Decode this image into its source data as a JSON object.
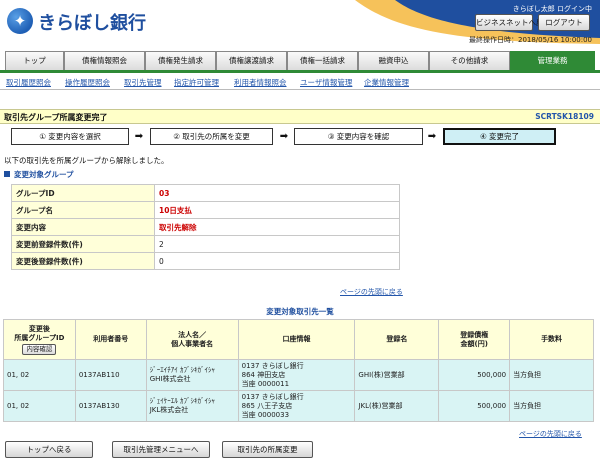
{
  "header": {
    "logo_text": "きらぼし銀行",
    "user_line": "きらぼし太郎 ログイン中",
    "biz_button": "ビジネスネットへ戻る",
    "logout_button": "ログアウト",
    "last_login": "最終操作日時：2018/05/16 10:00:00"
  },
  "tabs": [
    {
      "label": "トップ",
      "active": false
    },
    {
      "label": "債権情報照会",
      "active": false
    },
    {
      "label": "債権発生請求",
      "active": false
    },
    {
      "label": "債権譲渡請求",
      "active": false
    },
    {
      "label": "債権一括請求",
      "active": false
    },
    {
      "label": "融資申込",
      "active": false
    },
    {
      "label": "その他請求",
      "active": false
    },
    {
      "label": "管理業務",
      "active": true
    }
  ],
  "submenu": [
    "取引履歴照会",
    "操作履歴照会",
    "取引先管理",
    "指定許可管理",
    "利用者情報照会",
    "ユーザ情報管理",
    "企業情報管理"
  ],
  "title": {
    "text": "取引先グループ所属変更完了",
    "screen_id": "SCRTSK18109"
  },
  "steps": [
    "① 変更内容を選択",
    "② 取引先の所属を変更",
    "③ 変更内容を確認",
    "④ 変更完了"
  ],
  "message": "以下の取引先を所属グループから解除しました。",
  "group_section": {
    "heading": "変更対象グループ",
    "rows": [
      {
        "label": "グループID",
        "value": "03"
      },
      {
        "label": "グループ名",
        "value": "10日支払"
      },
      {
        "label": "変更内容",
        "value": "取引先解除"
      },
      {
        "label": "変更前登録件数(件)",
        "value": "2"
      },
      {
        "label": "変更後登録件数(件)",
        "value": "0"
      }
    ],
    "top_link": "ページの先頭に戻る"
  },
  "list": {
    "title": "変更対象取引先一覧",
    "headers": {
      "group_id_line1": "変更後",
      "group_id_line2": "所属グループID",
      "group_id_button": "内容確認",
      "user_no": "利用者番号",
      "name_line1": "法人名／",
      "name_line2": "個人事業者名",
      "account": "口座情報",
      "registered": "登録名",
      "amount_line1": "登録債権",
      "amount_line2": "金額(円)",
      "fee": "手数料"
    },
    "rows": [
      {
        "group_id": "01, 02",
        "user_no": "0137AB110",
        "name_kana": "ｼﾞｰｴｲﾁｱｲ ｶﾌﾞｼｷｶﾞｲｼｬ",
        "name": "GHI株式会社",
        "bank": "0137 きらぼし銀行",
        "branch": "864 神田支店",
        "account": "当座 0000011",
        "registered": "GHI(株)営業部",
        "amount": "500,000",
        "fee": "当方負担"
      },
      {
        "group_id": "01, 02",
        "user_no": "0137AB130",
        "name_kana": "ｼﾞｪｲｹｰｴﾙ ｶﾌﾞｼｷｶﾞｲｼｬ",
        "name": "JKL株式会社",
        "bank": "0137 きらぼし銀行",
        "branch": "865 八王子支店",
        "account": "当座 0000033",
        "registered": "JKL(株)営業部",
        "amount": "500,000",
        "fee": "当方負担"
      }
    ],
    "top_link": "ページの先頭に戻る"
  },
  "buttons": {
    "top": "トップへ戻る",
    "menu": "取引先管理メニューへ",
    "change": "取引先の所属変更"
  }
}
